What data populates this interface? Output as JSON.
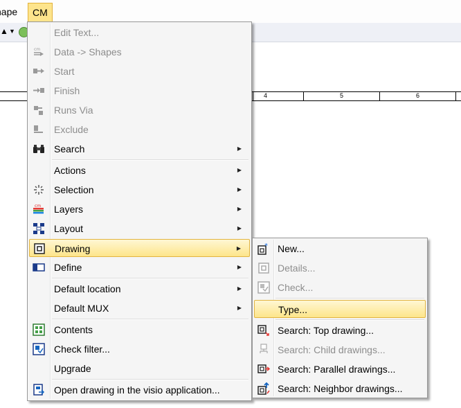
{
  "menubar": {
    "shape_label": "hape",
    "cm_label": "CM"
  },
  "ruler": {
    "labels": [
      "4",
      "5",
      "6"
    ]
  },
  "main_menu": {
    "edit_text": "Edit Text...",
    "data_shapes": "Data -> Shapes",
    "start": "Start",
    "finish": "Finish",
    "runs_via": "Runs Via",
    "exclude": "Exclude",
    "search": "Search",
    "actions": "Actions",
    "selection": "Selection",
    "layers": "Layers",
    "layout": "Layout",
    "drawing": "Drawing",
    "define": "Define",
    "default_location": "Default location",
    "default_mux": "Default MUX",
    "contents": "Contents",
    "check_filter": "Check filter...",
    "upgrade": "Upgrade",
    "open_visio": "Open drawing in the visio application..."
  },
  "drawing_submenu": {
    "new": "New...",
    "details": "Details...",
    "check": "Check...",
    "type": "Type...",
    "search_top": "Search: Top drawing...",
    "search_child": "Search: Child drawings...",
    "search_parallel": "Search: Parallel drawings...",
    "search_neighbor": "Search: Neighbor drawings..."
  },
  "colors": {
    "highlight": "#fde58a",
    "highlight_border": "#e2b440",
    "disabled_text": "#8d8d8d",
    "menu_bg": "#f5f5f5"
  }
}
